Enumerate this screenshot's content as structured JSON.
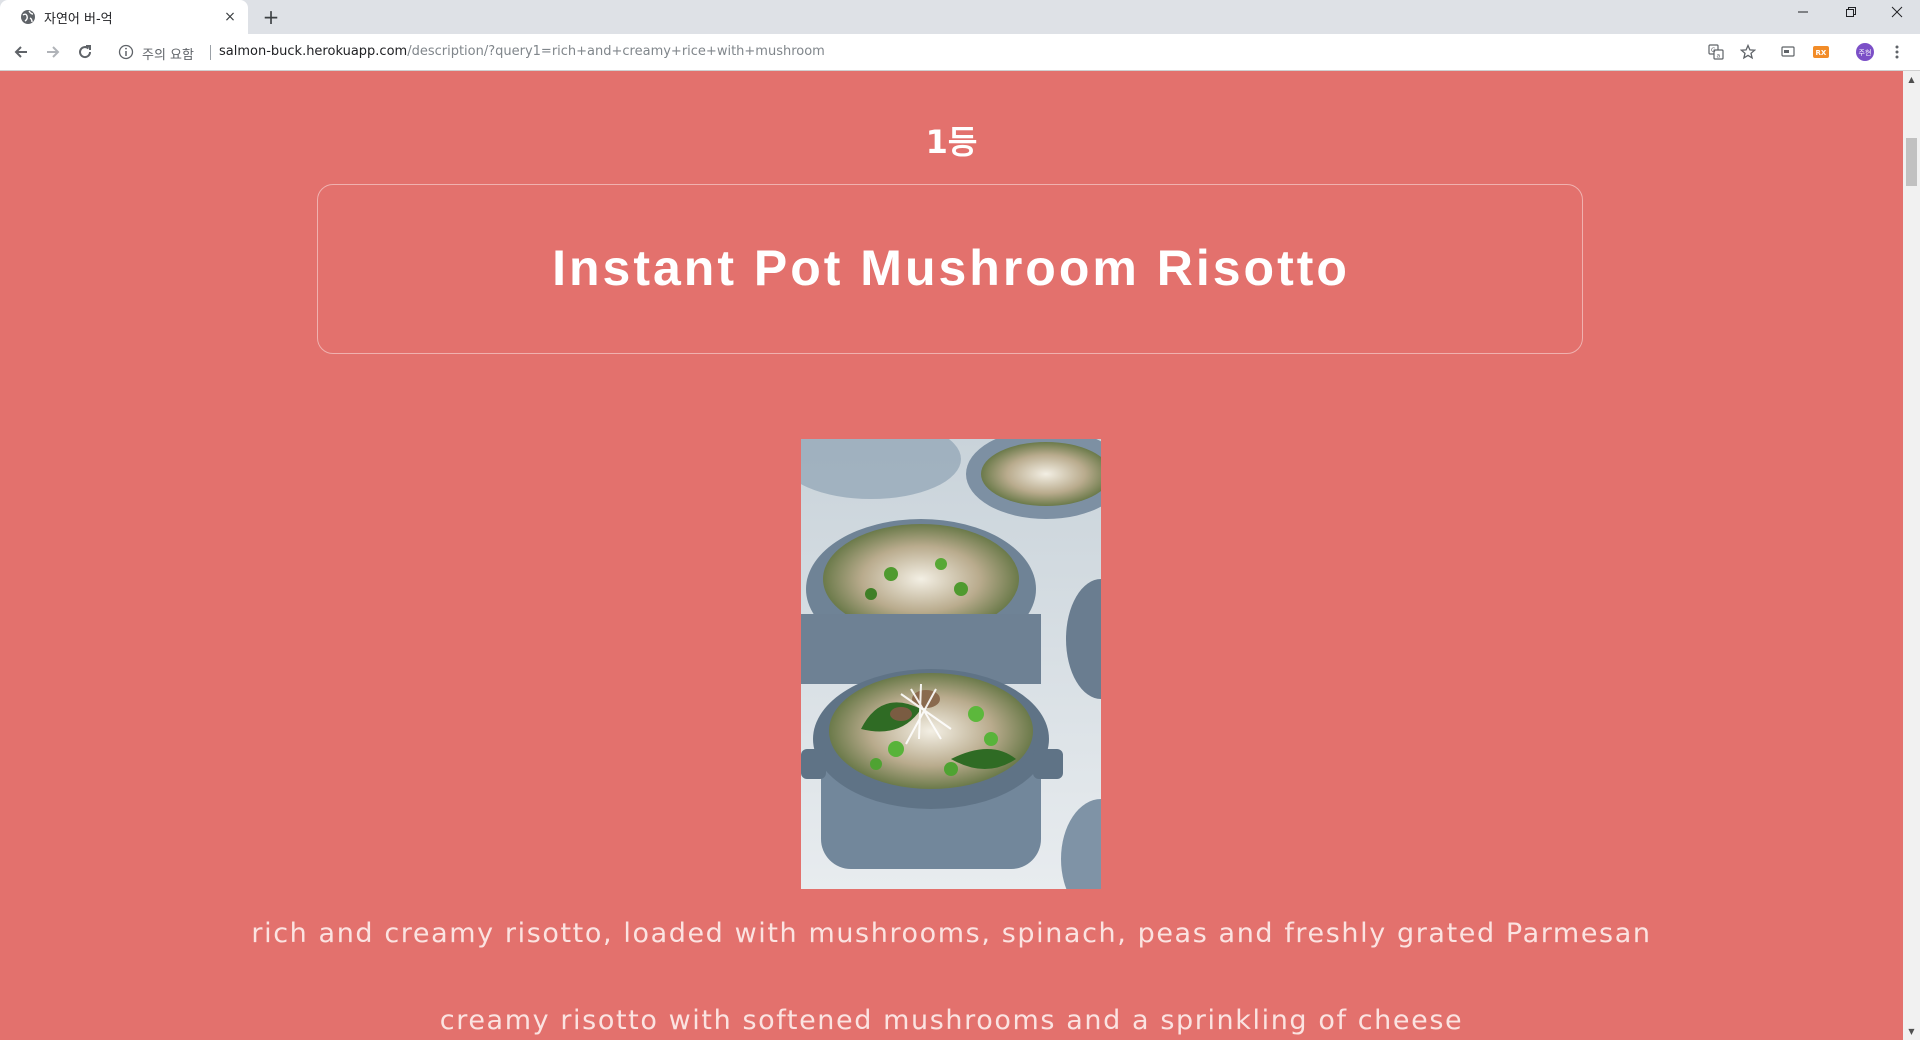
{
  "browser": {
    "tab": {
      "title": "자연어 버-억",
      "favicon": "globe-icon",
      "close_glyph": "×"
    },
    "new_tab_glyph": "+",
    "window_controls": {
      "minimize": "—",
      "maximize": "❐",
      "close": "✕"
    },
    "address_bar": {
      "security_label": "주의 요함",
      "url_host": "salmon-buck.herokuapp.com",
      "url_path": "/description/?query1=rich+and+creamy+rice+with+mushroom"
    },
    "profile_initials": "주현",
    "extension_label": "RX"
  },
  "page": {
    "background_color": "#e3716d",
    "rank": "1등",
    "recipe_title": "Instant Pot Mushroom Risotto",
    "image_alt": "mushroom risotto in small blue cocottes",
    "descriptions": [
      "rich and creamy risotto, loaded with mushrooms, spinach, peas and freshly grated Parmesan",
      "creamy risotto with softened mushrooms and a sprinkling of cheese"
    ]
  }
}
